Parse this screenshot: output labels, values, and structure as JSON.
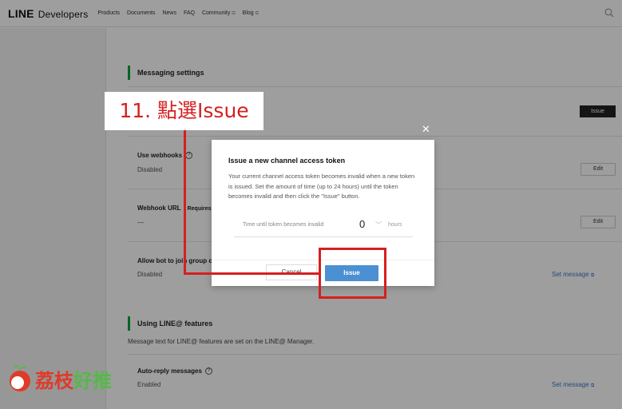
{
  "header": {
    "logo_line": "LINE",
    "logo_dev": "Developers",
    "nav": [
      "Products",
      "Documents",
      "News",
      "FAQ",
      "Community",
      "Blog"
    ]
  },
  "page": {
    "messaging_title": "Messaging settings",
    "issue_label": "Issue",
    "use_webhooks_label": "Use webhooks",
    "use_webhooks_value": "Disabled",
    "webhook_url_label": "Webhook URL",
    "webhook_url_requires": "Requires",
    "webhook_url_value": "—",
    "allow_bot_label": "Allow bot to join group ch",
    "allow_bot_value": "Disabled",
    "edit_label": "Edit",
    "set_message_label": "Set message",
    "line_at_title": "Using LINE@ features",
    "line_at_desc": "Message text for LINE@ features are set on the LINE@ Manager.",
    "auto_reply_label": "Auto-reply messages",
    "auto_reply_value": "Enabled"
  },
  "modal": {
    "title": "Issue a new channel access token",
    "body": "Your current channel access token becomes invalid when a new token is issued. Set the amount of time (up to 24 hours) until the token becomes invalid and then click the \"Issue\" button.",
    "field_label": "Time until token becomes invalid",
    "field_value": "0",
    "field_unit": "hours",
    "cancel_label": "Cancel",
    "issue_label": "Issue"
  },
  "annotation": {
    "step_text": "11. 點選Issue"
  },
  "watermark": {
    "text_a": "荔枝",
    "text_b": "好推"
  },
  "colors": {
    "accent_green": "#06a33a",
    "annotation_red": "#d42020",
    "primary_blue": "#4a90d2",
    "link_blue": "#3b7ac9"
  }
}
